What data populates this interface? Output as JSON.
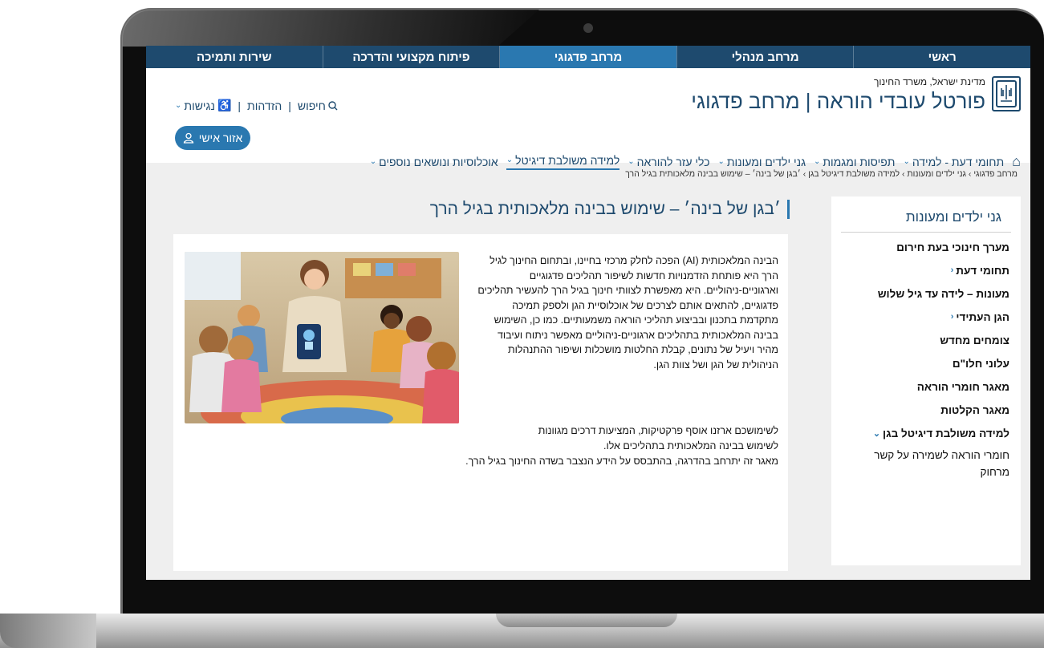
{
  "top_nav": [
    "ראשי",
    "מרחב מנהלי",
    "מרחב פדגוגי",
    "פיתוח מקצועי והדרכה",
    "שירות ותמיכה"
  ],
  "header": {
    "ministry": "מדינת ישראל, משרד החינוך",
    "portal_title": "פורטל עובדי הוראה | מרחב פדגוגי",
    "search": "חיפוש",
    "login": "הזדהות",
    "accessibility": "נגישות"
  },
  "main_nav": [
    "תחומי דעת - למידה",
    "תפיסות ומגמות",
    "גני ילדים ומעונות",
    "כלי עזר להוראה",
    "למידה משולבת דיגיטל",
    "אוכלוסיות ונושאים נוספים"
  ],
  "personal_area": "אזור אישי",
  "breadcrumb": "מרחב פדגוגי › גני ילדים ומעונות › למידה משולבת דיגיטל בגן › ׳בגן של בינה׳ – שימוש בבינה מלאכותית בגיל הרך",
  "sidebar": {
    "title": "גני ילדים ומעונות",
    "items": [
      {
        "label": "מערך חינוכי בעת חירום",
        "arrow": ""
      },
      {
        "label": "תחומי דעת",
        "arrow": "‹"
      },
      {
        "label": "מעונות – לידה עד גיל שלוש",
        "arrow": ""
      },
      {
        "label": "הגן העתידי",
        "arrow": "‹"
      },
      {
        "label": "צומחים מחדש",
        "arrow": ""
      },
      {
        "label": "עלוני חלו\"ם",
        "arrow": ""
      },
      {
        "label": "מאגר חומרי הוראה",
        "arrow": ""
      },
      {
        "label": "מאגר הקלטות",
        "arrow": ""
      },
      {
        "label": "למידה משולבת דיגיטל בגן",
        "arrow": "⌄"
      }
    ],
    "sub_item": "חומרי הוראה לשמירה על קשר מרחוק"
  },
  "article": {
    "title": "׳בגן של בינה׳ – שימוש בבינה מלאכותית בגיל הרך",
    "paragraph1": "הבינה המלאכותית (AI) הפכה לחלק מרכזי בחיינו, ובתחום החינוך לגיל הרך היא פותחת הזדמנויות חדשות לשיפור תהליכים פדגוגיים וארגוניים-ניהוליים. היא מאפשרת לצוותי חינוך בגיל הרך להעשיר תהליכים פדגוגיים, להתאים אותם לצרכים של אוכלוסיית הגן ולספק תמיכה מתקדמת בתכנון ובביצוע תהליכי הוראה משמעותיים. כמו כן, השימוש בבינה המלאכותית בתהליכים ארגוניים-ניהוליים מאפשר ניתוח ועיבוד מהיר ויעיל של נתונים, קבלת החלטות מושכלות ושיפור ההתנהלות הניהולית של הגן ושל צוות הגן.",
    "paragraph2_line1": "לשימושכם ארזנו אוסף פרקטיקות, המציעות דרכים מגוונות",
    "paragraph2_line2": "לשימוש בבינה המלאכותית בתהליכים אלו.",
    "paragraph2_line3": "מאגר זה יתרחב בהדרגה, בהתבסס על הידע הנצבר בשדה החינוך בגיל הרך."
  },
  "colors": {
    "nav_dark": "#1e4a6e",
    "nav_active": "#2a78b0",
    "accent": "#2a78b0"
  },
  "icons": [
    "home-icon",
    "search-icon",
    "accessibility-icon",
    "user-icon",
    "chevron-down-icon",
    "chevron-left-icon",
    "emblem-icon"
  ]
}
